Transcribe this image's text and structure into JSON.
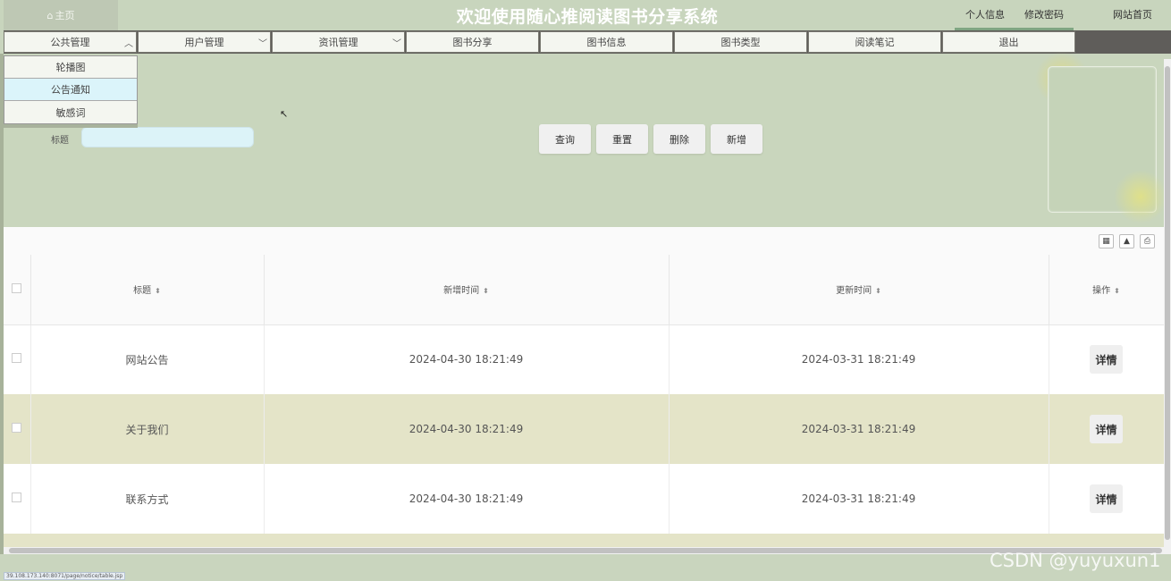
{
  "header": {
    "home_label": "主页",
    "title": "欢迎使用随心推阅读图书分享系统",
    "profile_link": "个人信息",
    "password_link": "修改密码",
    "site_home_link": "网站首页"
  },
  "nav": {
    "items": [
      {
        "label": "公共管理",
        "chevron": "up"
      },
      {
        "label": "用户管理",
        "chevron": "down"
      },
      {
        "label": "资讯管理",
        "chevron": "down"
      },
      {
        "label": "图书分享"
      },
      {
        "label": "图书信息"
      },
      {
        "label": "图书类型"
      },
      {
        "label": "阅读笔记"
      },
      {
        "label": "退出"
      }
    ]
  },
  "dropdown": {
    "items": [
      {
        "label": "轮播图"
      },
      {
        "label": "公告通知",
        "active": true
      },
      {
        "label": "敏感词"
      }
    ]
  },
  "search": {
    "title_label": "标题",
    "title_value": ""
  },
  "buttons": {
    "query": "查询",
    "reset": "重置",
    "delete": "删除",
    "add": "新增"
  },
  "table": {
    "columns": [
      "标题",
      "新增时间",
      "更新时间",
      "操作"
    ],
    "rows": [
      {
        "title": "网站公告",
        "created": "2024-04-30 18:21:49",
        "updated": "2024-03-31 18:21:49",
        "action": "详情"
      },
      {
        "title": "关于我们",
        "created": "2024-04-30 18:21:49",
        "updated": "2024-03-31 18:21:49",
        "action": "详情"
      },
      {
        "title": "联系方式",
        "created": "2024-04-30 18:21:49",
        "updated": "2024-03-31 18:21:49",
        "action": "详情"
      }
    ]
  },
  "status_url": "39.108.173.140:8071/page/notice/table.jsp",
  "watermark": "CSDN @yuyuxun1",
  "colors": {
    "header_bg": "#c8d5bd",
    "nav_item_bg": "#f4f6f0",
    "active_dropdown_bg": "#dbf4fa",
    "row_alt_bg": "#e4e4c8"
  },
  "icons": [
    "home-icon",
    "chevron-up-icon",
    "chevron-down-icon",
    "columns-icon",
    "export-icon",
    "print-icon",
    "sort-icon"
  ]
}
